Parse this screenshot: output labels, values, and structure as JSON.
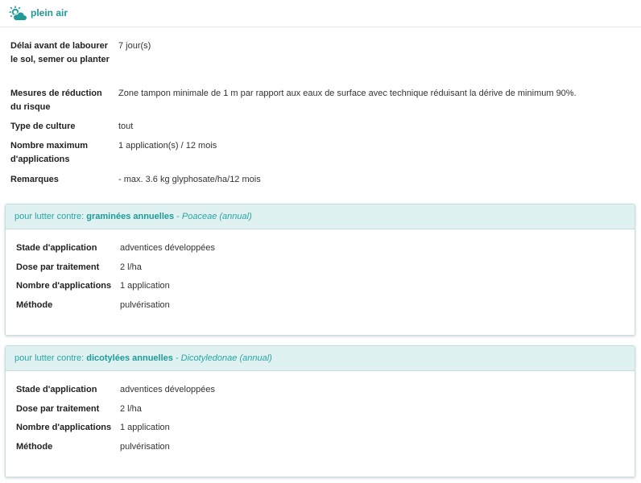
{
  "header": {
    "icon": "sun-cloud-icon",
    "title": "plein air",
    "accent_color": "#1f9a97"
  },
  "details": [
    {
      "label": "Délai avant de labourer le sol, semer ou planter",
      "value": "7 jour(s)"
    },
    {
      "label": "Mesures de réduction du risque",
      "value": "Zone tampon minimale de 1 m par rapport aux eaux de surface avec technique réduisant la dérive de minimum 90%."
    },
    {
      "label": "Type de culture",
      "value": "tout"
    },
    {
      "label": "Nombre maximum d'applications",
      "value": "1 application(s) / 12 mois"
    },
    {
      "label": "Remarques",
      "value": "- max. 3.6 kg glyphosate/ha/12 mois"
    }
  ],
  "panels": [
    {
      "prefix": "pour lutter contre:",
      "target": "graminées annuelles",
      "separator": " - ",
      "latin": "Poaceae (annual)",
      "rows": [
        {
          "label": "Stade d'application",
          "value": "adventices développées"
        },
        {
          "label": "Dose par traitement",
          "value": "2 l/ha"
        },
        {
          "label": "Nombre d'applications",
          "value": "1 application"
        },
        {
          "label": "Méthode",
          "value": "pulvérisation"
        }
      ]
    },
    {
      "prefix": "pour lutter contre:",
      "target": "dicotylées annuelles",
      "separator": " - ",
      "latin": "Dicotyledonae (annual)",
      "rows": [
        {
          "label": "Stade d'application",
          "value": "adventices développées"
        },
        {
          "label": "Dose par traitement",
          "value": "2 l/ha"
        },
        {
          "label": "Nombre d'applications",
          "value": "1 application"
        },
        {
          "label": "Méthode",
          "value": "pulvérisation"
        }
      ]
    }
  ]
}
